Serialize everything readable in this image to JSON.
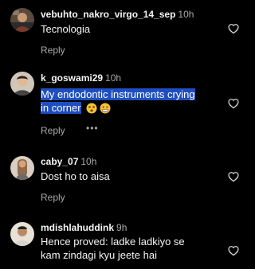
{
  "colors": {
    "background": "#000000",
    "text": "#f5f5f5",
    "secondary": "#a8a8a8",
    "selection": "#1f4fbf"
  },
  "comments": [
    {
      "username": "vebuhto_nakro_virgo_14_sep",
      "time": "10h",
      "text": "Tecnologia",
      "reply_label": "Reply",
      "icon": "heart-outline-icon"
    },
    {
      "username": "k_goswami29",
      "time": "10h",
      "text_line1": "My endodontic instruments crying",
      "text_line2": "in corner",
      "emojis": [
        "dizzy-face-emoji",
        "grimacing-emoji"
      ],
      "reply_label": "Reply",
      "more_label": "•••",
      "icon": "heart-outline-icon"
    },
    {
      "username": "caby_07",
      "time": "10h",
      "text": "Dost ho to aisa",
      "reply_label": "Reply",
      "icon": "heart-outline-icon"
    },
    {
      "username": "mdishlahuddink",
      "time": "9h",
      "text": "Hence proved: ladke ladkiyo se kam zindagi kyu jeete hai",
      "icon": "heart-outline-icon"
    }
  ]
}
